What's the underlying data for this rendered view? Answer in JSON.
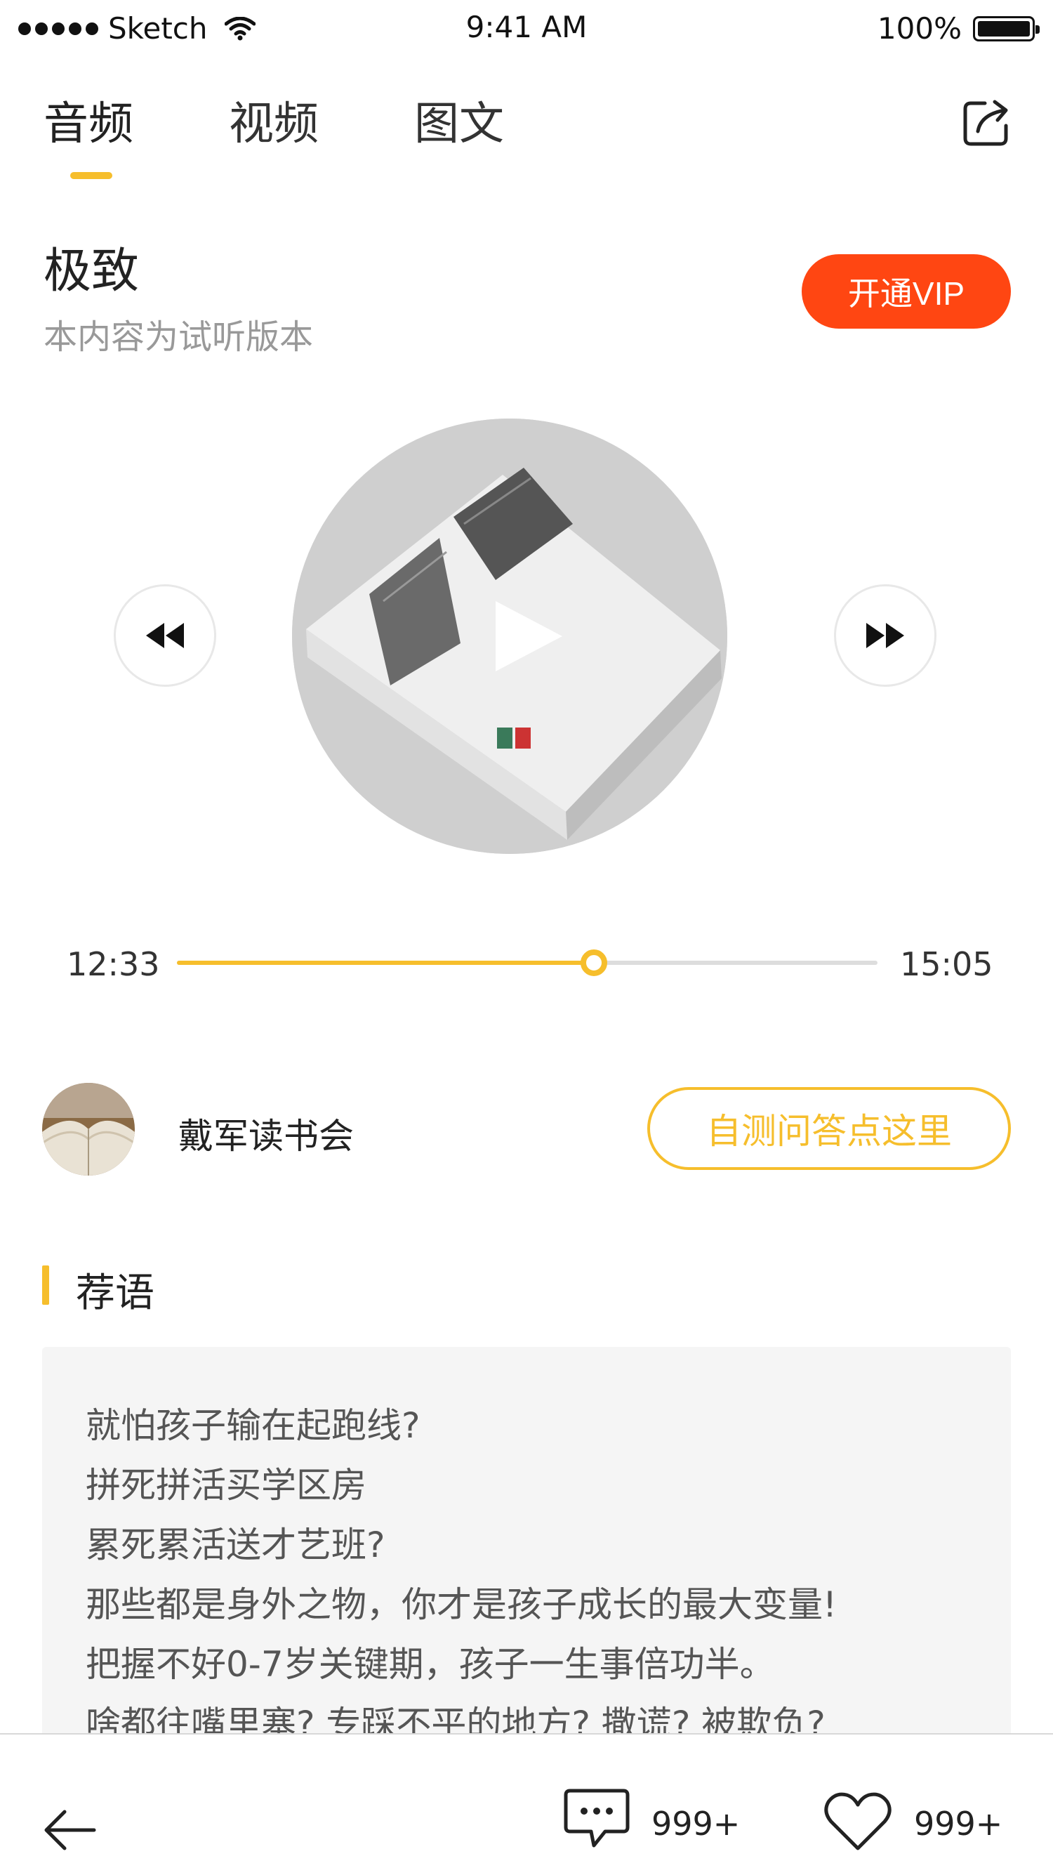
{
  "status_bar": {
    "carrier": "Sketch",
    "time": "9:41 AM",
    "battery": "100%"
  },
  "tabs": [
    {
      "label": "音频",
      "active": true
    },
    {
      "label": "视频",
      "active": false
    },
    {
      "label": "图文",
      "active": false
    }
  ],
  "header": {
    "title": "极致",
    "subtitle": "本内容为试听版本",
    "vip_label": "开通VIP"
  },
  "player": {
    "current_time": "12:33",
    "duration": "15:05",
    "progress": 0.595
  },
  "author": {
    "name": "戴军读书会",
    "quiz_label": "自测问答点这里"
  },
  "recommendation": {
    "title": "荐语",
    "lines": [
      "就怕孩子输在起跑线?",
      "拼死拼活买学区房",
      "累死累活送才艺班?",
      "那些都是身外之物，你才是孩子成长的最大变量!",
      "把握不好0-7岁关键期，孩子一生事倍功半。",
      "啥都往嘴里塞? 专踩不平的地方? 撒谎? 被欺负?"
    ]
  },
  "bottom_bar": {
    "comment_count": "999+",
    "like_count": "999+"
  },
  "colors": {
    "accent": "#F6BE2C",
    "vip": "#FF4612",
    "text_primary": "#222222",
    "text_secondary": "#999999"
  }
}
